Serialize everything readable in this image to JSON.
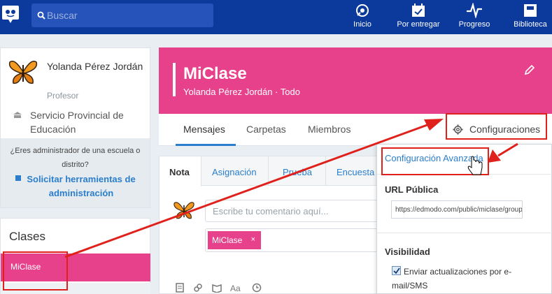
{
  "topbar": {
    "search_placeholder": "Buscar",
    "nav": [
      {
        "label": "Inicio",
        "icon": "home-icon"
      },
      {
        "label": "Por entregar",
        "icon": "calendar-check-icon"
      },
      {
        "label": "Progreso",
        "icon": "pulse-icon"
      },
      {
        "label": "Biblioteca",
        "icon": "library-icon"
      }
    ]
  },
  "profile": {
    "name": "Yolanda Pérez Jordán",
    "role": "Profesor",
    "school": "Servicio Provincial de Educación"
  },
  "admin": {
    "question": "¿Eres administrador de una escuela o distrito?",
    "link": "Solicitar herramientas de administración"
  },
  "clases": {
    "heading": "Clases",
    "selected": "MiClase"
  },
  "class_header": {
    "title": "MiClase",
    "subtitle": "Yolanda Pérez Jordán · Todo"
  },
  "tabs": {
    "mensajes": "Mensajes",
    "carpetas": "Carpetas",
    "miembros": "Miembros",
    "configuraciones": "Configuraciones"
  },
  "composer": {
    "tabs": [
      "Nota",
      "Asignación",
      "Prueba",
      "Encuesta"
    ],
    "comment_placeholder": "Escribe tu comentario aquí...",
    "recipient_chip": "MiClase",
    "chip_remove": "×"
  },
  "dropdown": {
    "advanced": "Configuración Avanzada",
    "url_label": "URL Pública",
    "url_value": "https://edmodo.com/public/miclase/group-id",
    "visibility_label": "Visibilidad",
    "checkbox_label": "Enviar actualizaciones por e-mail/SMS",
    "checkbox_checked": true
  },
  "colors": {
    "topbar": "#0c3a9c",
    "brand_pink": "#e8418c",
    "link_blue": "#2a7ecb",
    "annotation_red": "#e0201b"
  }
}
